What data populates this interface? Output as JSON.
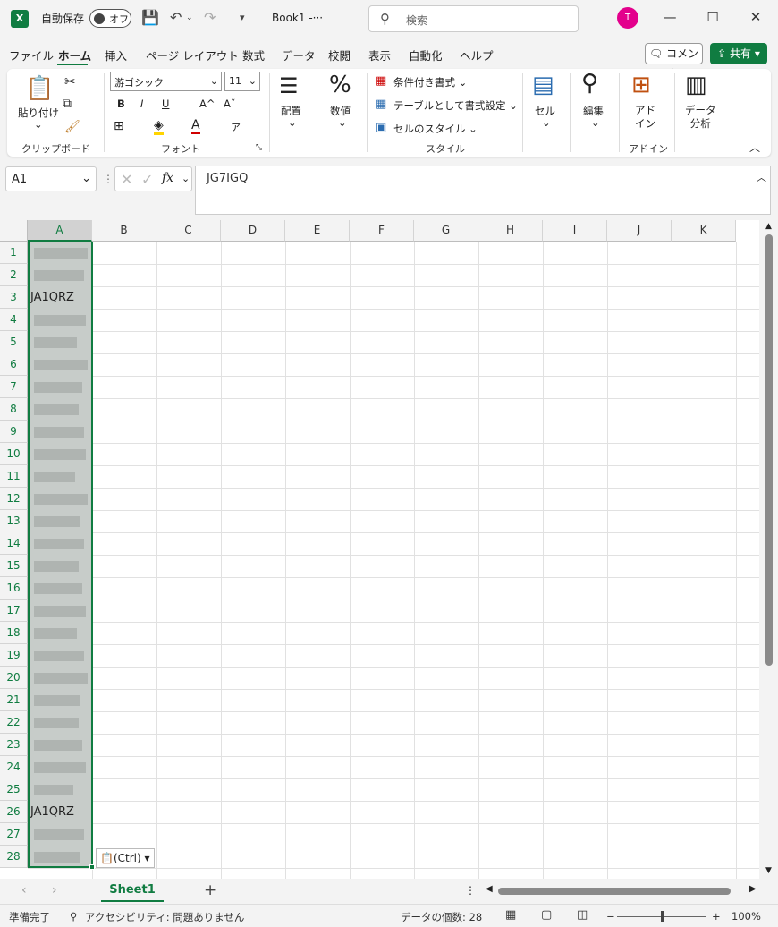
{
  "titlebar": {
    "app_icon": "X",
    "autosave_label": "自動保存",
    "autosave_state": "オフ",
    "doc_title": "Book1  -···",
    "search_placeholder": "検索",
    "avatar_initial": "T"
  },
  "tabs": [
    "ファイル",
    "ホーム",
    "挿入",
    "ページ レイアウト",
    "数式",
    "データ",
    "校閲",
    "表示",
    "自動化",
    "ヘルプ"
  ],
  "active_tab": "ホーム",
  "actions": {
    "comment": "コメント",
    "share": "共有"
  },
  "ribbon": {
    "clipboard": {
      "paste": "貼り付け",
      "label": "クリップボード"
    },
    "font": {
      "name": "游ゴシック",
      "size": "11",
      "label": "フォント",
      "bold": "B",
      "italic": "I",
      "underline": "U",
      "grow": "A^",
      "shrink": "Aˇ",
      "font_color": "A"
    },
    "align": {
      "label": "配置"
    },
    "number": {
      "label": "数値"
    },
    "styles": {
      "cond": "条件付き書式",
      "table": "テーブルとして書式設定",
      "cell": "セルのスタイル",
      "label": "スタイル"
    },
    "cells": {
      "label": "セル"
    },
    "edit": {
      "label": "編集"
    },
    "addin": {
      "btn": "アド\nイン",
      "label": "アドイン"
    },
    "analysis": {
      "btn": "データ\n分析"
    }
  },
  "formula": {
    "namebox": "A1",
    "fx": "fx",
    "content": "JG7IGQ"
  },
  "grid": {
    "columns": [
      "A",
      "B",
      "C",
      "D",
      "E",
      "F",
      "G",
      "H",
      "I",
      "J",
      "K"
    ],
    "rows": [
      "1",
      "2",
      "3",
      "4",
      "5",
      "6",
      "7",
      "8",
      "9",
      "10",
      "11",
      "12",
      "13",
      "14",
      "15",
      "16",
      "17",
      "18",
      "19",
      "20",
      "21",
      "22",
      "23",
      "24",
      "25",
      "26",
      "27",
      "28"
    ],
    "cell_a3": "JA1QRZ",
    "cell_a26": "JA1QRZ",
    "paste_options": "(Ctrl)"
  },
  "sheets": {
    "active": "Sheet1"
  },
  "status": {
    "ready": "準備完了",
    "accessibility": "アクセシビリティ: 問題ありません",
    "count": "データの個数: 28",
    "zoom": "100%"
  }
}
